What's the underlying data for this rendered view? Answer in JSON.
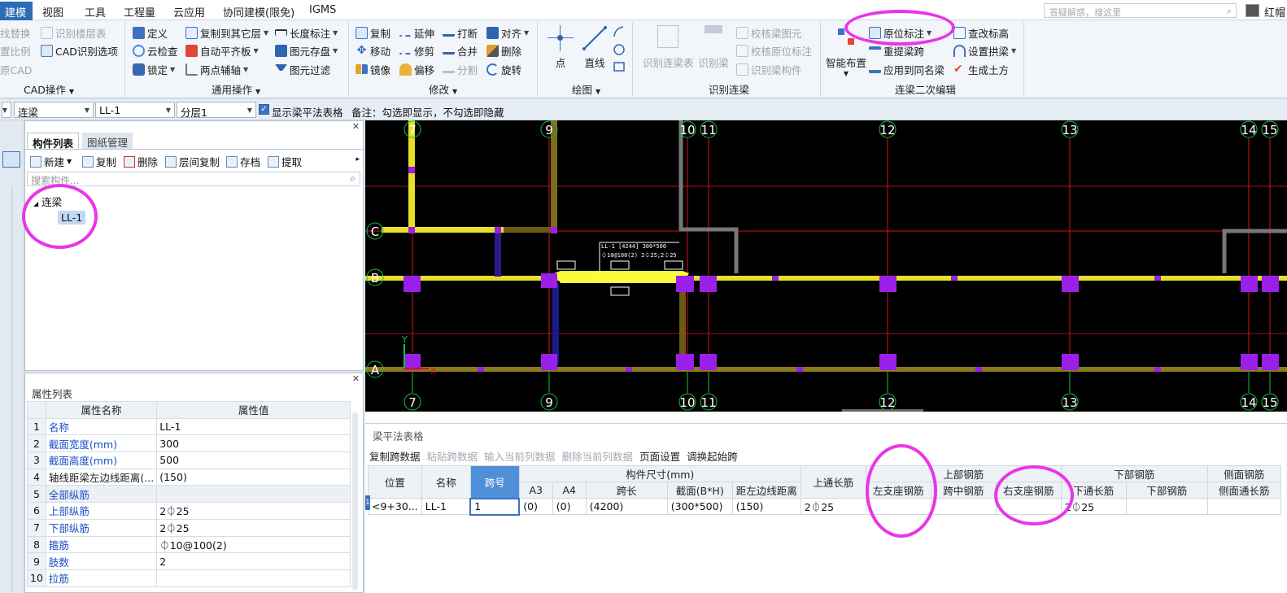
{
  "menu": {
    "items": [
      "建模",
      "视图",
      "工具",
      "工程量",
      "云应用",
      "协同建模(限免)",
      "IGMS"
    ],
    "search_placeholder": "答疑解惑，搜这里",
    "user": "红帽"
  },
  "ribbon": {
    "cad": {
      "b1": "找替换",
      "b2": "识别楼层表",
      "b3": "置比例",
      "b4": "CAD识别选项",
      "b5": "原CAD",
      "label": "CAD操作"
    },
    "common": {
      "define": "定义",
      "copy_other": "复制到其它层",
      "cloud_check": "云检查",
      "auto_flat": "自动平齐板",
      "lock": "锁定",
      "two_point": "两点辅轴",
      "length_mark": "长度标注",
      "save_elem": "图元存盘",
      "filter": "图元过滤",
      "label": "通用操作"
    },
    "modify": {
      "copy": "复制",
      "extend": "延伸",
      "break": "打断",
      "align": "对齐",
      "move": "移动",
      "trim": "修剪",
      "merge": "合并",
      "delete": "删除",
      "mirror": "镜像",
      "offset": "偏移",
      "split": "分割",
      "rotate": "旋转",
      "label": "修改"
    },
    "draw": {
      "point": "点",
      "line": "直线",
      "label": "绘图"
    },
    "recog": {
      "recog_table": "识别连梁表",
      "recog_beam": "识别梁",
      "check_elem": "校核梁图元",
      "check_orig": "校核原位标注",
      "recog_comp": "识别梁构件",
      "label": "识别连梁"
    },
    "edit": {
      "smart": "智能布置",
      "orig_mark": "原位标注",
      "reextract": "重提梁跨",
      "apply_same": "应用到同名梁",
      "check_elev": "查改标高",
      "set_arch": "设置拱梁",
      "gen_earth": "生成土方",
      "label": "连梁二次编辑"
    }
  },
  "filterbar": {
    "type": "连梁",
    "name": "LL-1",
    "floor": "分层1",
    "show_table_label": "显示梁平法表格",
    "note": "备注：勾选即显示，不勾选即隐藏"
  },
  "comp_panel": {
    "tabs": [
      "构件列表",
      "图纸管理"
    ],
    "toolbar": [
      "新建",
      "复制",
      "删除",
      "层间复制",
      "存档",
      "提取"
    ],
    "search_placeholder": "搜索构件...",
    "tree_root": "连梁",
    "tree_child": "LL-1"
  },
  "prop_panel": {
    "title": "属性列表",
    "col_name": "属性名称",
    "col_value": "属性值",
    "rows": [
      {
        "n": "1",
        "k": "名称",
        "v": "LL-1",
        "blue": true
      },
      {
        "n": "2",
        "k": "截面宽度(mm)",
        "v": "300",
        "blue": true
      },
      {
        "n": "3",
        "k": "截面高度(mm)",
        "v": "500",
        "blue": true
      },
      {
        "n": "4",
        "k": "轴线距梁左边线距离(...",
        "v": "(150)",
        "blue": false
      },
      {
        "n": "5",
        "k": "全部纵筋",
        "v": "",
        "blue": true
      },
      {
        "n": "6",
        "k": "上部纵筋",
        "v": "2⏀25",
        "blue": true
      },
      {
        "n": "7",
        "k": "下部纵筋",
        "v": "2⏀25",
        "blue": true
      },
      {
        "n": "8",
        "k": "箍筋",
        "v": "⏀10@100(2)",
        "blue": true
      },
      {
        "n": "9",
        "k": "肢数",
        "v": "2",
        "blue": true
      },
      {
        "n": "10",
        "k": "拉筋",
        "v": "",
        "blue": true
      }
    ]
  },
  "canvas": {
    "axes_top": [
      "7",
      "9",
      "10",
      "11",
      "12",
      "13",
      "14",
      "15"
    ],
    "rows": [
      "C",
      "B",
      "A"
    ],
    "beam_text_1": "LL-1 [4244] 300*500",
    "beam_text_2": "⏀10@100(2) 2⏀25;2⏀25",
    "coord_y": "Y",
    "coord_x": "X"
  },
  "bottom": {
    "title": "梁平法表格",
    "toolbar": [
      {
        "t": "复制跨数据",
        "dis": false
      },
      {
        "t": "粘贴跨数据",
        "dis": true
      },
      {
        "t": "输入当前列数据",
        "dis": true
      },
      {
        "t": "删除当前列数据",
        "dis": true
      },
      {
        "t": "页面设置",
        "dis": false
      },
      {
        "t": "调换起始跨",
        "dis": false
      }
    ],
    "headers": {
      "pos": "位置",
      "name": "名称",
      "span": "跨号",
      "dims": "构件尺寸(mm)",
      "a3": "A3",
      "a4": "A4",
      "span_len": "跨长",
      "section": "截面(B*H)",
      "dist": "距左边线距离",
      "top_through": "上通长筋",
      "top_rebar": "上部钢筋",
      "left_sup": "左支座钢筋",
      "mid": "跨中钢筋",
      "right_sup": "右支座钢筋",
      "bot_rebar": "下部钢筋",
      "bot_through": "下通长筋",
      "bot": "下部钢筋",
      "side": "侧面钢筋",
      "side_through": "侧面通长筋"
    },
    "row": {
      "idx": "1",
      "pos": "<9+30...",
      "name": "LL-1",
      "span": "1",
      "a3": "(0)",
      "a4": "(0)",
      "span_len": "(4200)",
      "section": "(300*500)",
      "dist": "(150)",
      "top_through": "2⏀25",
      "left_sup": "",
      "mid": "",
      "right_sup": "",
      "bot_through": "2⏀25",
      "bot": "",
      "side_through": ""
    }
  },
  "colors": {
    "accent": "#2c6db5",
    "highlight": "#e935e8",
    "beam_yellow": "#ffff33",
    "column_purple": "#9a1fe8",
    "axis_red": "#d8131b",
    "axis_green": "#1bbf3a"
  }
}
